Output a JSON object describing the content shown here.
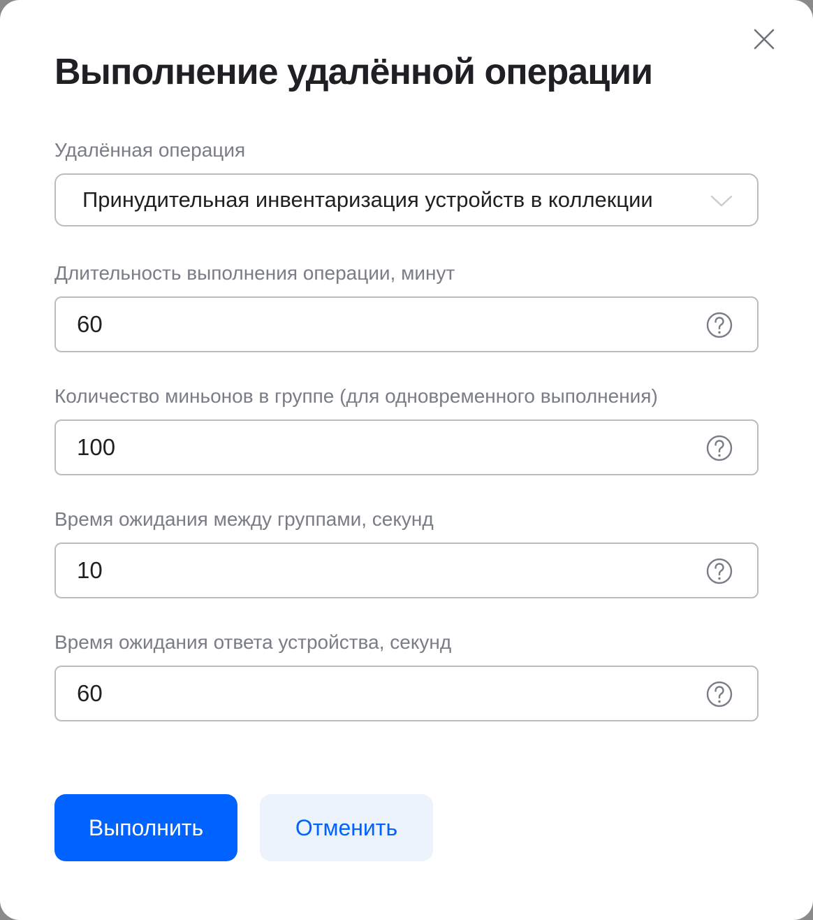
{
  "dialog": {
    "title": "Выполнение удалённой операции",
    "close_label": "close-icon"
  },
  "fields": {
    "operation": {
      "label": "Удалённая операция",
      "value": "Принудительная инвентаризация устройств в коллекции"
    },
    "duration": {
      "label": "Длительность выполнения операции, минут",
      "value": "60"
    },
    "minions": {
      "label": "Количество миньонов в группе (для одновременного выполнения)",
      "value": "100"
    },
    "group_wait": {
      "label": "Время ожидания между группами, секунд",
      "value": "10"
    },
    "response_wait": {
      "label": "Время ожидания ответа устройства, секунд",
      "value": "60"
    }
  },
  "actions": {
    "submit_label": "Выполнить",
    "cancel_label": "Отменить"
  },
  "colors": {
    "primary": "#0062ff",
    "secondary_bg": "#edf3fd",
    "border": "#b9bcc2",
    "label": "#7a7d86",
    "text": "#1f1f24"
  },
  "icons": {
    "close": "close-icon",
    "dropdown": "chevron-down-icon",
    "help": "help-circle-icon"
  }
}
